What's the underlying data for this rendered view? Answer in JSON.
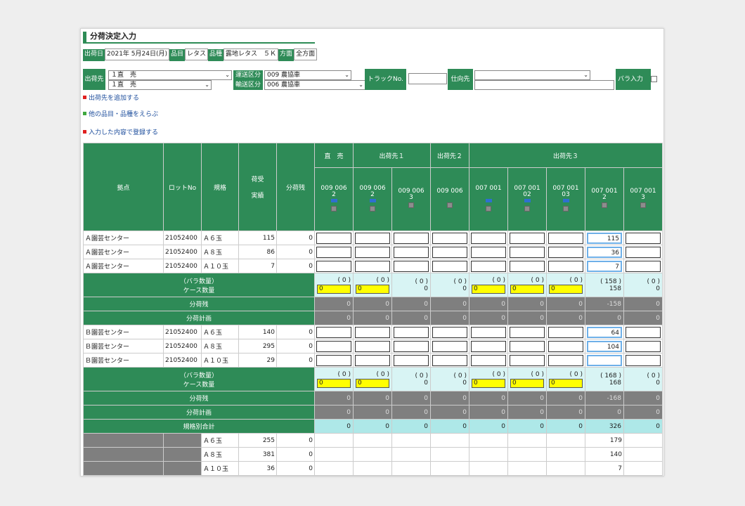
{
  "title": "分荷決定入力",
  "info": [
    {
      "label": "出荷日",
      "value": "2021年 5月24日(月)"
    },
    {
      "label": "品目",
      "value": "レタス"
    },
    {
      "label": "品種",
      "value": "露地レタス　５Ｋ"
    },
    {
      "label": "方面",
      "value": "全方面"
    }
  ],
  "filters": {
    "dest_label": "出荷先",
    "dest_select_1": "１直　売",
    "dest_select_2": "１直　売",
    "unso_label": "運送区分",
    "unso_value": "009 農協車",
    "yuso_label": "輸送区分",
    "yuso_value": "006 農協車",
    "truck_label": "トラックNo.",
    "shimuke_label": "仕向先",
    "bara_label": "バラ入力"
  },
  "links": [
    "出荷先を追加する",
    "他の品目・品種をえらぶ",
    "入力した内容で登録する"
  ],
  "header": {
    "kyoten": "拠点",
    "lot": "ロットNo",
    "kikaku": "規格",
    "jisseki_1": "荷受",
    "jisseki_2": "実績",
    "zan": "分荷残",
    "groups": [
      "直　売",
      "出荷先１",
      "出荷先２",
      "出荷先３"
    ],
    "codes": [
      [
        "009 006",
        "2"
      ],
      [
        "009 006",
        "2"
      ],
      [
        "009 006",
        "3"
      ],
      [
        "009 006",
        ""
      ],
      [
        "007 001",
        ""
      ],
      [
        "007 001",
        "02"
      ],
      [
        "007 001",
        "03"
      ],
      [
        "007 001",
        "2"
      ],
      [
        "007 001",
        "3"
      ]
    ]
  },
  "block_a": {
    "rows": [
      {
        "kyoten": "Ａ園芸センター",
        "lot": "21052400",
        "kikaku": "Ａ６玉",
        "jisseki": "115",
        "zan": "0",
        "inputs": [
          "",
          "",
          "",
          "",
          "",
          "",
          "",
          "115",
          ""
        ]
      },
      {
        "kyoten": "Ａ園芸センター",
        "lot": "21052400",
        "kikaku": "Ａ８玉",
        "jisseki": "86",
        "zan": "0",
        "inputs": [
          "",
          "",
          "",
          "",
          "",
          "",
          "",
          "36",
          ""
        ]
      },
      {
        "kyoten": "Ａ園芸センター",
        "lot": "21052400",
        "kikaku": "Ａ１０玉",
        "jisseki": "7",
        "zan": "0",
        "inputs": [
          "",
          "",
          "",
          "",
          "",
          "",
          "",
          "7",
          ""
        ]
      }
    ],
    "bara_label": "（バラ数量）",
    "case_label": "ケース数量",
    "bara": [
      "( 0 )",
      "( 0 )",
      "( 0 )",
      "( 0 )",
      "( 0 )",
      "( 0 )",
      "( 0 )",
      "( 158 )",
      "( 0 )"
    ],
    "case": [
      "0",
      "0",
      "0",
      "0",
      "0",
      "0",
      "0",
      "158",
      "0"
    ],
    "zan_label": "分荷残",
    "zan": [
      "0",
      "0",
      "0",
      "0",
      "0",
      "0",
      "0",
      "-158",
      "0"
    ],
    "plan_label": "分荷計画",
    "plan": [
      "0",
      "0",
      "0",
      "0",
      "0",
      "0",
      "0",
      "0",
      "0"
    ]
  },
  "block_b": {
    "rows": [
      {
        "kyoten": "Ｂ園芸センター",
        "lot": "21052400",
        "kikaku": "Ａ６玉",
        "jisseki": "140",
        "zan": "0",
        "inputs": [
          "",
          "",
          "",
          "",
          "",
          "",
          "",
          "64",
          ""
        ]
      },
      {
        "kyoten": "Ｂ園芸センター",
        "lot": "21052400",
        "kikaku": "Ａ８玉",
        "jisseki": "295",
        "zan": "0",
        "inputs": [
          "",
          "",
          "",
          "",
          "",
          "",
          "",
          "104",
          ""
        ]
      },
      {
        "kyoten": "Ｂ園芸センター",
        "lot": "21052400",
        "kikaku": "Ａ１０玉",
        "jisseki": "29",
        "zan": "0",
        "inputs": [
          "",
          "",
          "",
          "",
          "",
          "",
          "",
          "",
          ""
        ]
      }
    ],
    "bara_label": "（バラ数量）",
    "case_label": "ケース数量",
    "bara": [
      "( 0 )",
      "( 0 )",
      "( 0 )",
      "( 0 )",
      "( 0 )",
      "( 0 )",
      "( 0 )",
      "( 168 )",
      "( 0 )"
    ],
    "case": [
      "0",
      "0",
      "0",
      "0",
      "0",
      "0",
      "0",
      "168",
      "0"
    ],
    "zan_label": "分荷残",
    "zan": [
      "0",
      "0",
      "0",
      "0",
      "0",
      "0",
      "0",
      "-168",
      "0"
    ],
    "plan_label": "分荷計画",
    "plan": [
      "0",
      "0",
      "0",
      "0",
      "0",
      "0",
      "0",
      "0",
      "0"
    ]
  },
  "total_label": "規格別合計",
  "total": [
    "0",
    "0",
    "0",
    "0",
    "0",
    "0",
    "0",
    "326",
    "0"
  ],
  "summary": [
    {
      "kikaku": "Ａ６玉",
      "jisseki": "255",
      "zan": "0",
      "col8": "179"
    },
    {
      "kikaku": "Ａ８玉",
      "jisseki": "381",
      "zan": "0",
      "col8": "140"
    },
    {
      "kikaku": "Ａ１０玉",
      "jisseki": "36",
      "zan": "0",
      "col8": "7"
    }
  ],
  "colors": {
    "green": "#2e8b57",
    "light_blue": "#d8f4f4",
    "gray": "#7f7f7f",
    "yellow": "#ffff00"
  }
}
